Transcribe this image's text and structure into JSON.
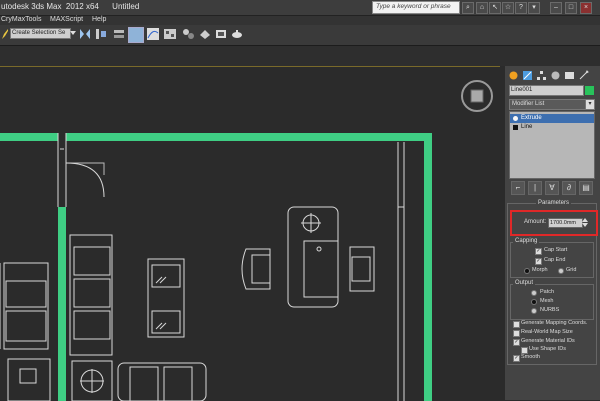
{
  "window": {
    "title": "utodesk 3ds Max  2012 x64      Untitled",
    "search_placeholder": "Type a keyword or phrase"
  },
  "menubar": {
    "items": [
      "CryMaxTools",
      "MAXScript",
      "Help"
    ]
  },
  "toolbar": {
    "selection_set": "Create Selection Se"
  },
  "command_panel": {
    "object_name": "Line001",
    "object_color": "#28c35b",
    "modifier_list": "Modifier List",
    "stack": [
      {
        "label": "Extrude",
        "selected": true
      },
      {
        "label": "Line",
        "selected": false
      }
    ]
  },
  "parameters": {
    "rollout_title": "Parameters",
    "amount_label": "Amount:",
    "amount_value": "1700.0mm",
    "capping": {
      "title": "Capping",
      "cap_start": "Cap Start",
      "cap_end": "Cap End",
      "morph": "Morph",
      "grid": "Grid"
    },
    "output": {
      "title": "Output",
      "patch": "Patch",
      "mesh": "Mesh",
      "nurbs": "NURBS"
    },
    "options": {
      "gen_mapping": "Generate Mapping Coords.",
      "real_world": "Real-World Map Size",
      "gen_material": "Generate Material IDs",
      "use_shape": "Use Shape IDs",
      "smooth": "Smooth"
    }
  },
  "colors": {
    "wall": "#3fce84",
    "highlight": "#e02828",
    "accent_selection": "#3d6fb0"
  }
}
